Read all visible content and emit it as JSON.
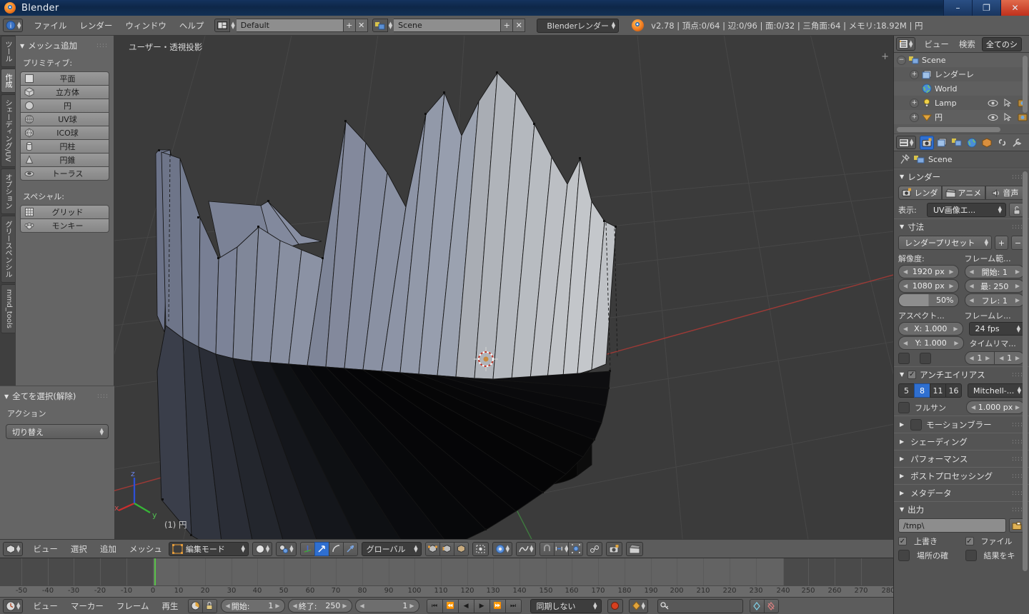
{
  "window": {
    "title": "Blender",
    "minimize": "–",
    "maximize": "❐",
    "close": "✕"
  },
  "info_header": {
    "menus": [
      "ファイル",
      "レンダー",
      "ウィンドウ",
      "ヘルプ"
    ],
    "screen_layout": "Default",
    "scene_name": "Scene",
    "add_label": "+",
    "remove_label": "✕",
    "render_engine": "Blenderレンダー",
    "stats": "v2.78 | 頂点:0/64 | 辺:0/96 | 面:0/32 | 三角面:64 | メモリ:18.92M | 円"
  },
  "tool_tabs": [
    {
      "label": "ツール",
      "active": false
    },
    {
      "label": "作成",
      "active": true
    },
    {
      "label": "シェーディング/UV",
      "active": false
    },
    {
      "label": "オプション",
      "active": false
    },
    {
      "label": "グリースペンシル",
      "active": false
    },
    {
      "label": "mmd_tools",
      "active": false
    }
  ],
  "toolshelf": {
    "panel_title": "メッシュ追加",
    "primitives_label": "プリミティブ:",
    "primitives": [
      {
        "label": "平面",
        "icon": "plane-icon"
      },
      {
        "label": "立方体",
        "icon": "cube-icon"
      },
      {
        "label": "円",
        "icon": "circle-icon"
      },
      {
        "label": "UV球",
        "icon": "uvsphere-icon"
      },
      {
        "label": "ICO球",
        "icon": "icosphere-icon"
      },
      {
        "label": "円柱",
        "icon": "cylinder-icon"
      },
      {
        "label": "円錐",
        "icon": "cone-icon"
      },
      {
        "label": "トーラス",
        "icon": "torus-icon"
      }
    ],
    "special_label": "スペシャル:",
    "special": [
      {
        "label": "グリッド",
        "icon": "grid-icon"
      },
      {
        "label": "モンキー",
        "icon": "monkey-icon"
      }
    ]
  },
  "operator_panel": {
    "title": "全てを選択(解除)",
    "action_label": "アクション",
    "action_value": "切り替え"
  },
  "viewport": {
    "view_label": "ユーザー・透視投影",
    "object_label": "(1) 円",
    "axis_x": "x",
    "axis_y": "y",
    "axis_z": "z"
  },
  "viewport_header": {
    "menus": [
      "ビュー",
      "選択",
      "追加",
      "メッシュ"
    ],
    "mode": "編集モード",
    "transform_orientation": "グローバル"
  },
  "timeline": {
    "menus": [
      "ビュー",
      "マーカー",
      "フレーム",
      "再生"
    ],
    "start_label": "開始:",
    "start_value": "1",
    "end_label": "終了:",
    "end_value": "250",
    "current_frame": "1",
    "sync_mode": "同期しない",
    "ruler_ticks": [
      "-50",
      "-40",
      "-30",
      "-20",
      "-10",
      "0",
      "10",
      "20",
      "30",
      "40",
      "50",
      "60",
      "70",
      "80",
      "90",
      "100",
      "110",
      "120",
      "130",
      "140",
      "150",
      "160",
      "170",
      "180",
      "190",
      "200",
      "210",
      "220",
      "230",
      "240",
      "250",
      "260",
      "270",
      "280"
    ],
    "playhead_frame": "1"
  },
  "outliner": {
    "display_menu": "ビュー",
    "search_menu": "検索",
    "filter": "全てのシ",
    "rows": [
      {
        "label": "Scene",
        "icon": "scene-icon",
        "indent": 0,
        "selected": true,
        "expander": "−"
      },
      {
        "label": "レンダーレ",
        "icon": "renderlayer-icon",
        "indent": 1,
        "selected": false,
        "expander": "+"
      },
      {
        "label": "World",
        "icon": "world-icon",
        "indent": 1,
        "selected": false,
        "expander": ""
      },
      {
        "label": "Lamp",
        "icon": "lamp-icon",
        "indent": 1,
        "selected": false,
        "expander": "+"
      },
      {
        "label": "円",
        "icon": "mesh-icon",
        "indent": 1,
        "selected": false,
        "expander": "+"
      }
    ]
  },
  "properties": {
    "tabs": [
      "render-tab",
      "renderlayers-tab",
      "scene-tab",
      "world-tab",
      "object-tab",
      "constraints-tab",
      "modifiers-tab"
    ],
    "breadcrumb": "Scene",
    "render": {
      "title": "レンダー",
      "render_button": "レンダ",
      "animation_button": "アニメ",
      "audio_button": "音声",
      "display_label": "表示:",
      "display_value": "UV画像エ..."
    },
    "dimensions": {
      "title": "寸法",
      "preset": "レンダープリセット",
      "preset_add": "+",
      "preset_remove": "−",
      "resolution_label": "解像度:",
      "resolution_x": "1920 px",
      "resolution_y": "1080 px",
      "resolution_pct": "50%",
      "frame_range_label": "フレーム範...",
      "frame_start": "開始:  1",
      "frame_end": "最:  250",
      "frame_step": "フレ:  1",
      "aspect_label": "アスペクト...",
      "aspect_x": "X: 1.000",
      "aspect_y": "Y: 1.000",
      "framerate_label": "フレームレ...",
      "framerate": "24 fps",
      "timeremap_label": "タイムリマ...",
      "timeremap_old": "1",
      "timeremap_new": "1"
    },
    "antialiasing": {
      "title": "アンチエイリアス",
      "checked": true,
      "samples": [
        "5",
        "8",
        "11",
        "16"
      ],
      "samples_active": "8",
      "filter": "Mitchell-...",
      "fullsample_label": "フルサン",
      "fullsample_checked": false,
      "size_value": "1.000 px"
    },
    "collapsed_sections": [
      {
        "title": "モーションブラー",
        "has_toggle": true
      },
      {
        "title": "シェーディング",
        "has_toggle": false
      },
      {
        "title": "パフォーマンス",
        "has_toggle": false
      },
      {
        "title": "ポストプロセッシング",
        "has_toggle": false
      },
      {
        "title": "メタデータ",
        "has_toggle": false
      }
    ],
    "output": {
      "title": "出力",
      "path": "/tmp\\",
      "overwrite_label": "上書き",
      "overwrite_checked": true,
      "file_label": "ファイル",
      "file_checked": true,
      "placeholder_label": "場所の確",
      "placeholder_checked": false,
      "cache_label": "結果をキ",
      "cache_checked": false
    }
  },
  "colors": {
    "accent_blue": "#2f6fd0",
    "header_gray": "#5c5c5c",
    "viewport_bg": "#3b3b3b",
    "playhead_green": "#5ac24a",
    "axis_x_red": "#a33c38",
    "axis_y_green": "#3f8b3f",
    "orange": "#f27c21"
  }
}
